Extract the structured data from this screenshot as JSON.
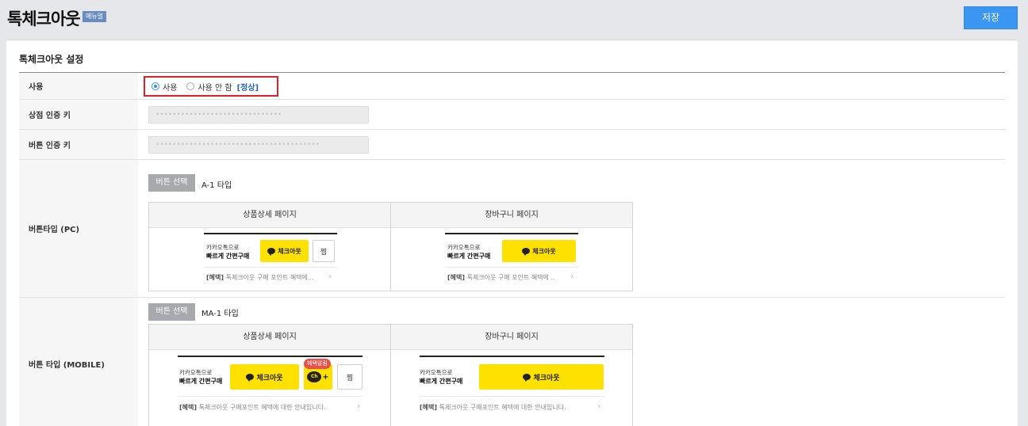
{
  "header": {
    "title": "톡체크아웃",
    "manual_badge": "매뉴얼",
    "save_label": "저장"
  },
  "panel": {
    "title": "톡체크아웃 설정"
  },
  "rows": {
    "use": {
      "label": "사용",
      "option_on": "사용",
      "option_off": "사용 안 함",
      "status": "[정상]"
    },
    "store_key": {
      "label": "상점 인증 키",
      "value": "••••••••••••••••••••••••••••••"
    },
    "button_key": {
      "label": "버튼 인증 키",
      "value": "•••••••••••••••••••••••••••••••••••••••"
    },
    "pc_type": {
      "label": "버튼타입 (PC)",
      "select_label": "버튼 선택",
      "type_name": "A-1 타입"
    },
    "mobile_type": {
      "label": "버튼 타입 (MOBILE)",
      "select_label": "버튼 선택",
      "type_name": "MA-1 타입"
    }
  },
  "preview": {
    "detail_page": "상품상세 페이지",
    "cart_page": "장바구니 페이지",
    "promo_line1": "카카오톡으로",
    "promo_line2": "빠르게 간편구매",
    "checkout_label": "체크아웃",
    "wish_label": "찜",
    "pc_benefit_tag": "[혜택]",
    "pc_benefit_text": "톡체크아웃 구매 포인트 혜택에...",
    "pc_benefit_text_cart": "톡체크아웃 구매 포인트 혜택에 ..",
    "mobile_benefit_text": "톡체크아웃 구매포인트 혜택에 대한 안내입니다.",
    "benefit_badge": "혜택알림",
    "ch_label": "Ch",
    "ch_plus": "+",
    "chevron": "›"
  },
  "colors": {
    "accent": "#3a96f2",
    "kakao_yellow": "#ffe100",
    "highlight_border": "#e41f25",
    "status_link": "#2563b8"
  }
}
